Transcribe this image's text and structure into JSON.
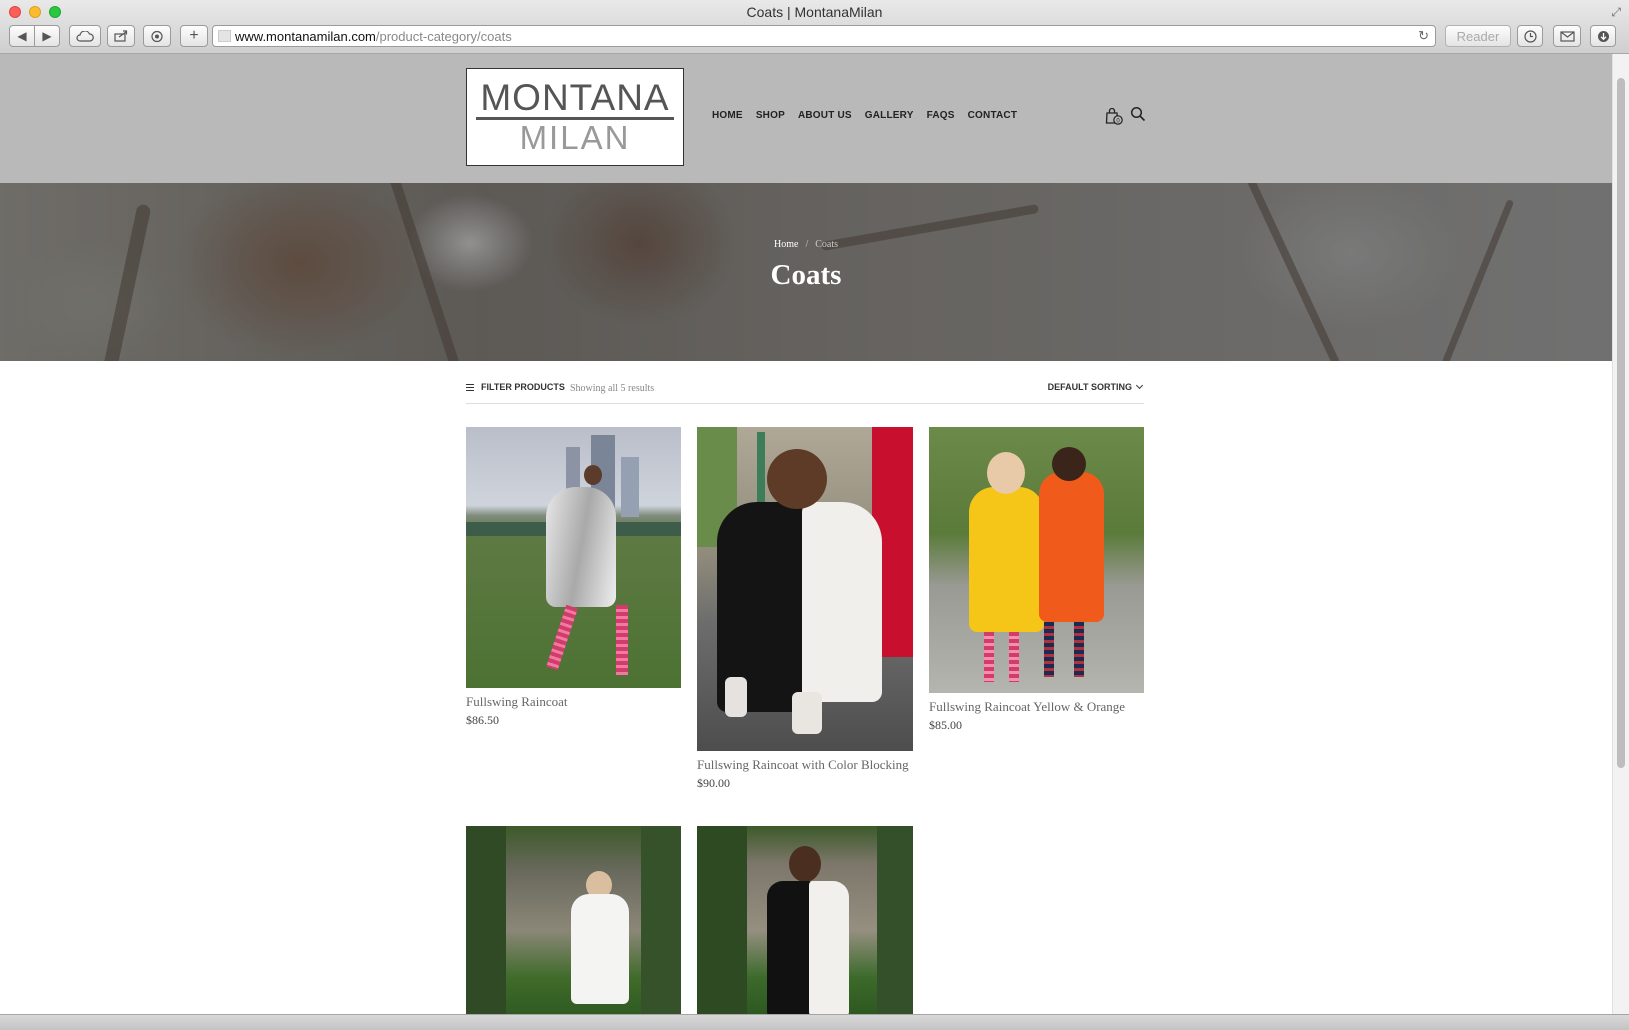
{
  "window": {
    "title": "Coats | MontanaMilan",
    "url_host": "www.montanamilan.com",
    "url_path": "/product-category/coats",
    "reader_label": "Reader"
  },
  "header": {
    "logo_top": "MONTANA",
    "logo_bottom": "MILAN",
    "nav": [
      "HOME",
      "SHOP",
      "ABOUT US",
      "GALLERY",
      "FAQS",
      "CONTACT"
    ],
    "cart_count": "0"
  },
  "hero": {
    "breadcrumb_home": "Home",
    "breadcrumb_sep": "/",
    "breadcrumb_current": "Coats",
    "title": "Coats"
  },
  "toolbar": {
    "filter_label": "FILTER PRODUCTS",
    "results": "Showing all 5 results",
    "sorting": "DEFAULT SORTING"
  },
  "products": [
    {
      "name": "Fullswing Raincoat",
      "price": "$86.50"
    },
    {
      "name": "Fullswing Raincoat with Color Blocking",
      "price": "$90.00"
    },
    {
      "name": "Fullswing Raincoat Yellow & Orange",
      "price": "$85.00"
    },
    {
      "name": "",
      "price": ""
    },
    {
      "name": "",
      "price": ""
    }
  ],
  "colors": {
    "header_bg": "#b9b9b9",
    "text_dark": "#222222",
    "product_name": "#666666"
  }
}
